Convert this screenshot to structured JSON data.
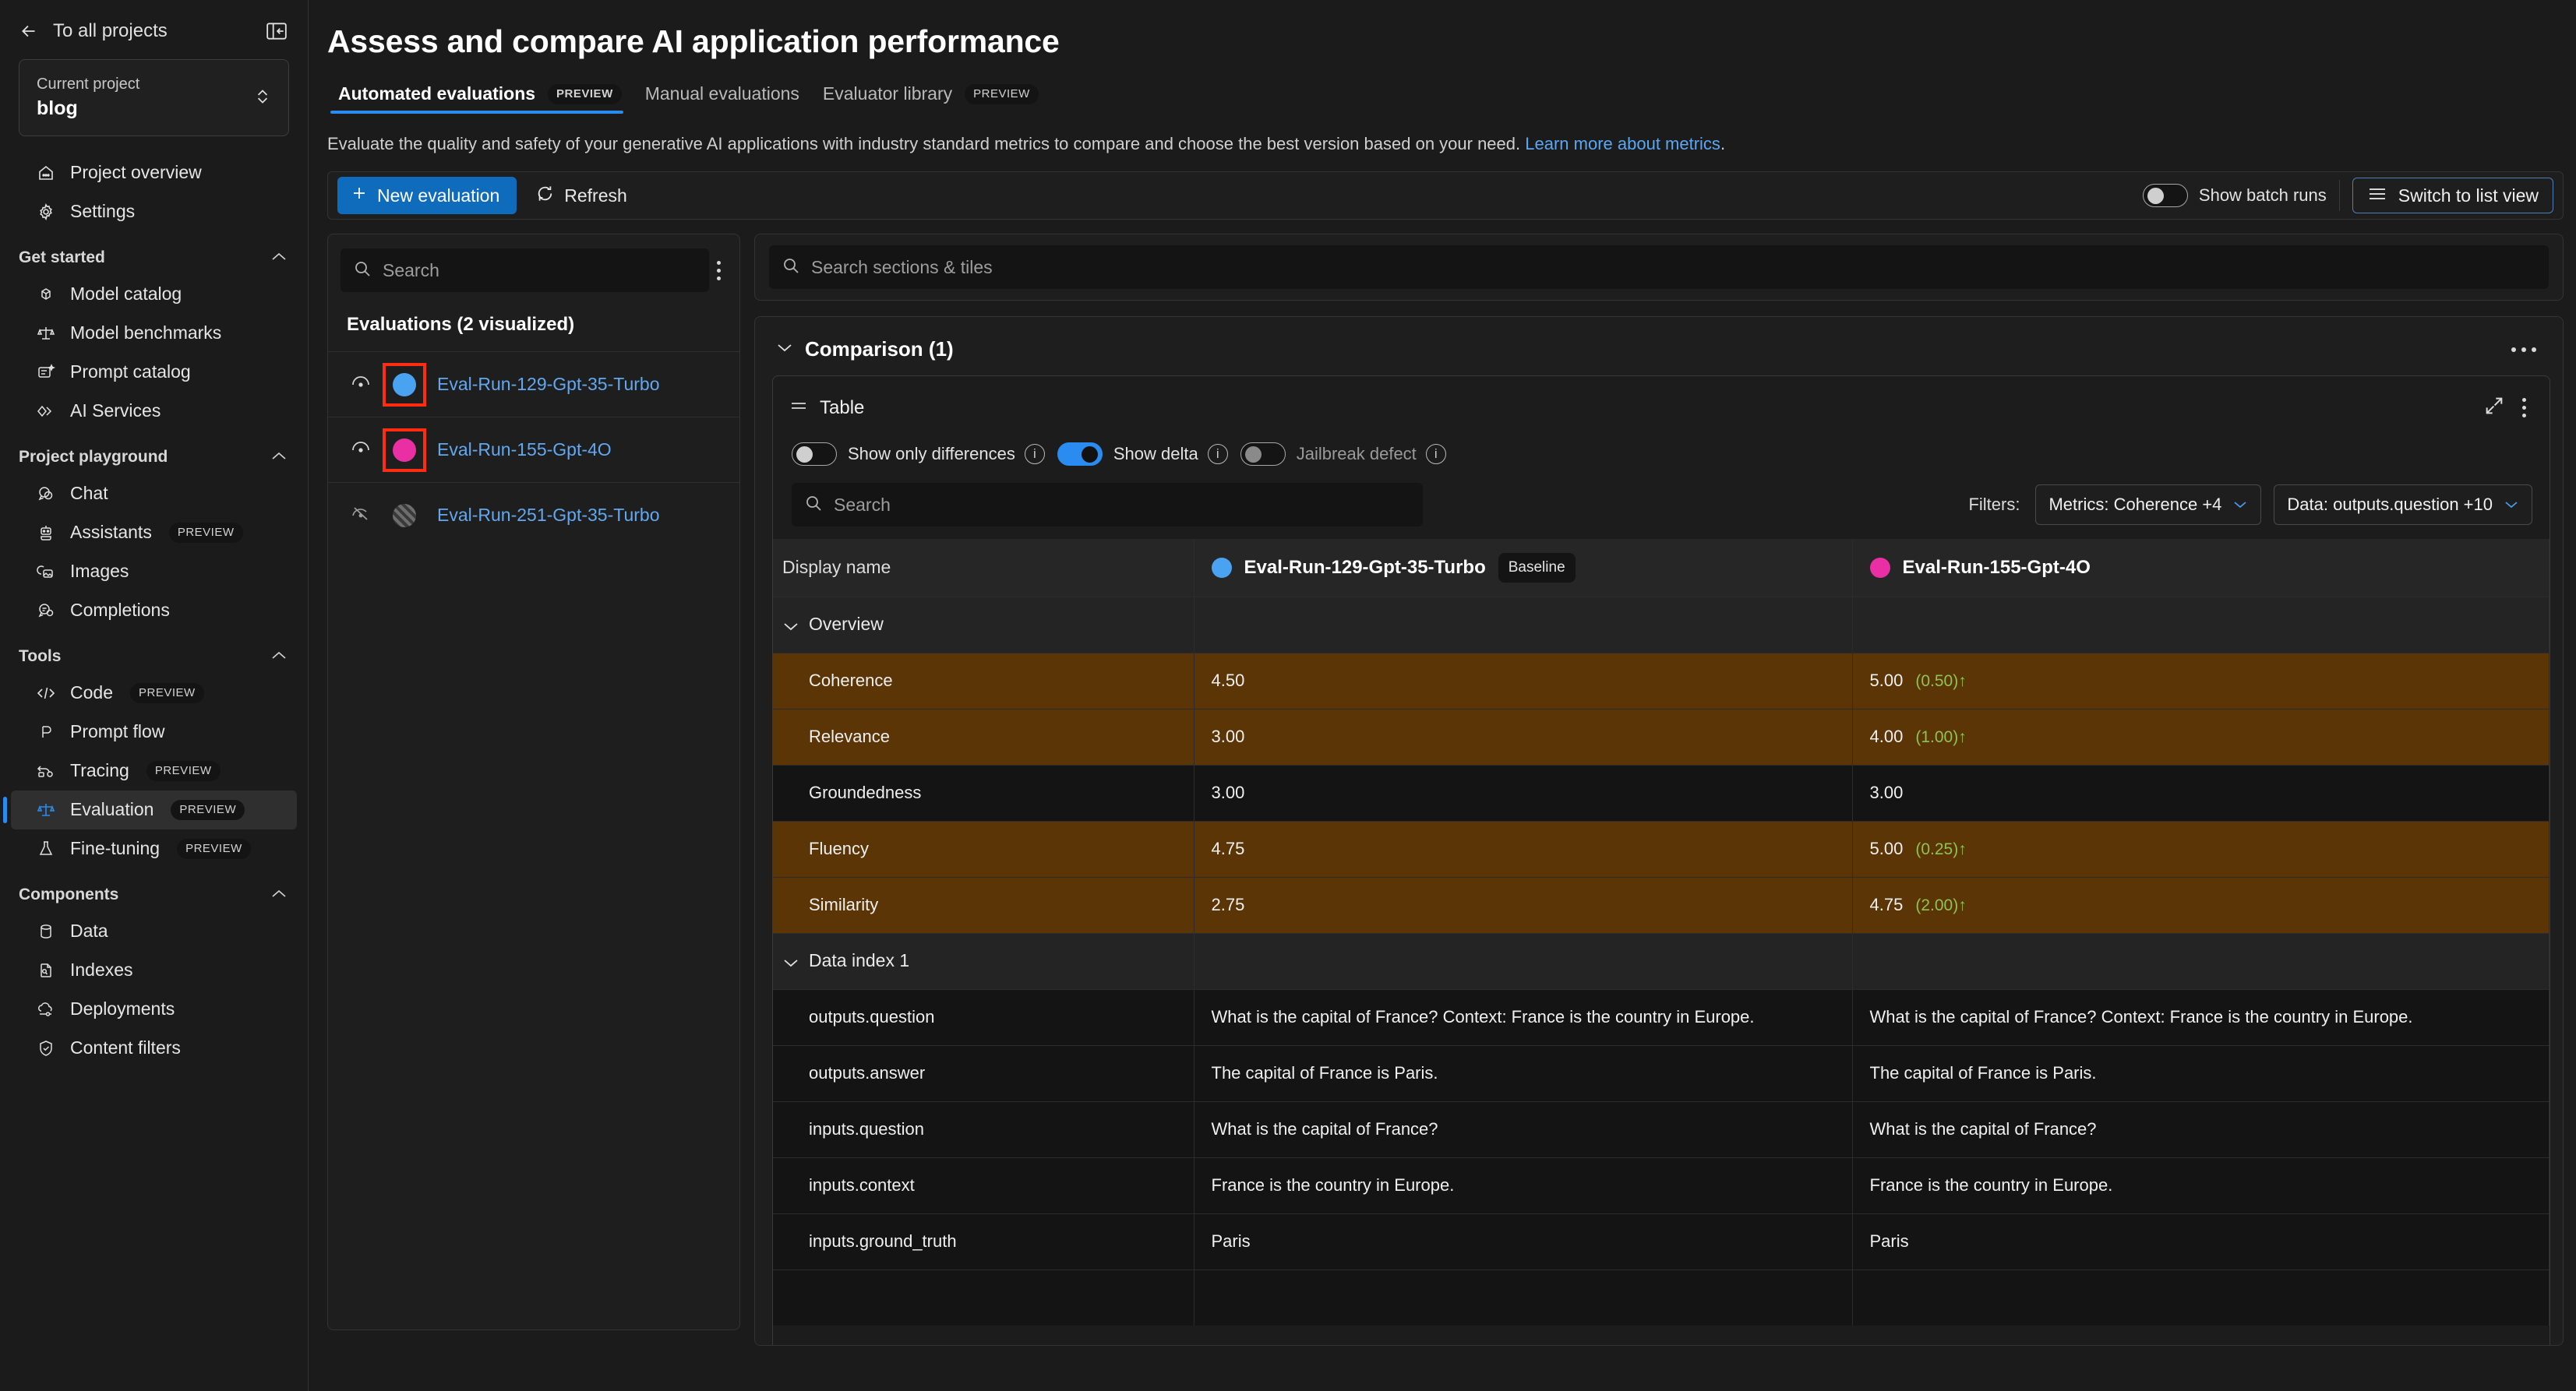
{
  "sidebar": {
    "back_label": "To all projects",
    "project": {
      "label": "Current project",
      "value": "blog"
    },
    "top_items": [
      {
        "label": "Project overview",
        "icon": "home-icon"
      },
      {
        "label": "Settings",
        "icon": "gear-icon"
      }
    ],
    "groups": [
      {
        "title": "Get started",
        "items": [
          {
            "label": "Model catalog",
            "icon": "cube-icon",
            "badge": ""
          },
          {
            "label": "Model benchmarks",
            "icon": "scales-icon",
            "badge": ""
          },
          {
            "label": "Prompt catalog",
            "icon": "prompt-icon",
            "badge": ""
          },
          {
            "label": "AI Services",
            "icon": "services-icon",
            "badge": ""
          }
        ]
      },
      {
        "title": "Project playground",
        "items": [
          {
            "label": "Chat",
            "icon": "chat-icon",
            "badge": ""
          },
          {
            "label": "Assistants",
            "icon": "robot-icon",
            "badge": "PREVIEW"
          },
          {
            "label": "Images",
            "icon": "image-icon",
            "badge": ""
          },
          {
            "label": "Completions",
            "icon": "completions-icon",
            "badge": ""
          }
        ]
      },
      {
        "title": "Tools",
        "items": [
          {
            "label": "Code",
            "icon": "code-icon",
            "badge": "PREVIEW"
          },
          {
            "label": "Prompt flow",
            "icon": "flow-icon",
            "badge": ""
          },
          {
            "label": "Tracing",
            "icon": "tracing-icon",
            "badge": "PREVIEW"
          },
          {
            "label": "Evaluation",
            "icon": "scales-icon",
            "badge": "PREVIEW",
            "active": true
          },
          {
            "label": "Fine-tuning",
            "icon": "flask-icon",
            "badge": "PREVIEW"
          }
        ]
      },
      {
        "title": "Components",
        "items": [
          {
            "label": "Data",
            "icon": "database-icon",
            "badge": ""
          },
          {
            "label": "Indexes",
            "icon": "index-icon",
            "badge": ""
          },
          {
            "label": "Deployments",
            "icon": "cloud-icon",
            "badge": ""
          },
          {
            "label": "Content filters",
            "icon": "shield-icon",
            "badge": ""
          }
        ]
      }
    ]
  },
  "header": {
    "title": "Assess and compare AI application performance",
    "tabs": [
      {
        "label": "Automated evaluations",
        "badge": "PREVIEW",
        "active": true
      },
      {
        "label": "Manual evaluations",
        "badge": "",
        "active": false
      },
      {
        "label": "Evaluator library",
        "badge": "PREVIEW",
        "active": false
      }
    ],
    "subtitle_text": "Evaluate the quality and safety of your generative AI applications with industry standard metrics to compare and choose the best version based on your need.",
    "subtitle_link": "Learn more about metrics",
    "subtitle_tail": "."
  },
  "toolbar": {
    "new_evaluation": "New evaluation",
    "refresh": "Refresh",
    "show_batch_runs": "Show batch runs",
    "show_batch_runs_on": false,
    "switch_to_list_view": "Switch to list view"
  },
  "eval_panel": {
    "search_placeholder": "Search",
    "search_value": "",
    "heading": "Evaluations (2 visualized)",
    "rows": [
      {
        "name": "Eval-Run-129-Gpt-35-Turbo",
        "color": "#4aa3f0",
        "visible": true,
        "highlighted": true
      },
      {
        "name": "Eval-Run-155-Gpt-4O",
        "color": "#ea2fa4",
        "visible": true,
        "highlighted": true
      },
      {
        "name": "Eval-Run-251-Gpt-35-Turbo",
        "color": "",
        "visible": false,
        "highlighted": false
      }
    ]
  },
  "canvas": {
    "section_search_placeholder": "Search sections & tiles",
    "section_search_value": "",
    "comparison_title": "Comparison (1)"
  },
  "table_card": {
    "title": "Table",
    "toggles": [
      {
        "label": "Show only differences",
        "on": false,
        "dim": false
      },
      {
        "label": "Show delta",
        "on": true,
        "dim": false
      },
      {
        "label": "Jailbreak defect",
        "on": false,
        "dim": true
      }
    ],
    "search_placeholder": "Search",
    "search_value": "",
    "filters_label": "Filters:",
    "filters": [
      {
        "label": "Metrics: Coherence +4"
      },
      {
        "label": "Data: outputs.question +10"
      }
    ]
  },
  "chart_data": {
    "type": "table",
    "title": "Comparison (1) — Table",
    "display_name_label": "Display name",
    "columns": [
      {
        "name": "Eval-Run-129-Gpt-35-Turbo",
        "color": "#4aa3f0",
        "baseline_badge": "Baseline"
      },
      {
        "name": "Eval-Run-155-Gpt-4O",
        "color": "#ea2fa4",
        "baseline_badge": ""
      }
    ],
    "sections": [
      {
        "label": "Overview",
        "rows": [
          {
            "label": "Coherence",
            "v1": "4.50",
            "v2": "5.00",
            "delta": "(0.50)",
            "dir": "up",
            "highlight": true
          },
          {
            "label": "Relevance",
            "v1": "3.00",
            "v2": "4.00",
            "delta": "(1.00)",
            "dir": "up",
            "highlight": true
          },
          {
            "label": "Groundedness",
            "v1": "3.00",
            "v2": "3.00",
            "delta": "",
            "dir": "",
            "highlight": false
          },
          {
            "label": "Fluency",
            "v1": "4.75",
            "v2": "5.00",
            "delta": "(0.25)",
            "dir": "up",
            "highlight": true
          },
          {
            "label": "Similarity",
            "v1": "2.75",
            "v2": "4.75",
            "delta": "(2.00)",
            "dir": "up",
            "highlight": true
          }
        ]
      },
      {
        "label": "Data index 1",
        "rows": [
          {
            "label": "outputs.question",
            "v1": "What is the capital of France? Context: France is the country in Europe.",
            "v2": "What is the capital of France? Context: France is the country in Europe.",
            "delta": "",
            "dir": "",
            "highlight": false
          },
          {
            "label": "outputs.answer",
            "v1": "The capital of France is Paris.",
            "v2": "The capital of France is Paris.",
            "delta": "",
            "dir": "",
            "highlight": false
          },
          {
            "label": "inputs.question",
            "v1": "What is the capital of France?",
            "v2": "What is the capital of France?",
            "delta": "",
            "dir": "",
            "highlight": false
          },
          {
            "label": "inputs.context",
            "v1": "France is the country in Europe.",
            "v2": "France is the country in Europe.",
            "delta": "",
            "dir": "",
            "highlight": false
          },
          {
            "label": "inputs.ground_truth",
            "v1": "Paris",
            "v2": "Paris",
            "delta": "",
            "dir": "",
            "highlight": false
          },
          {
            "label": "",
            "v1": "",
            "v2": "",
            "delta": "",
            "dir": "",
            "highlight": false
          }
        ]
      }
    ]
  },
  "colors": {
    "accent": "#0f6cbd",
    "link": "#5aa7f5",
    "highlight_row": "#5b3505",
    "delta_positive": "#8fc34f",
    "run1": "#4aa3f0",
    "run2": "#ea2fa4",
    "annotation": "#ff2b12"
  }
}
